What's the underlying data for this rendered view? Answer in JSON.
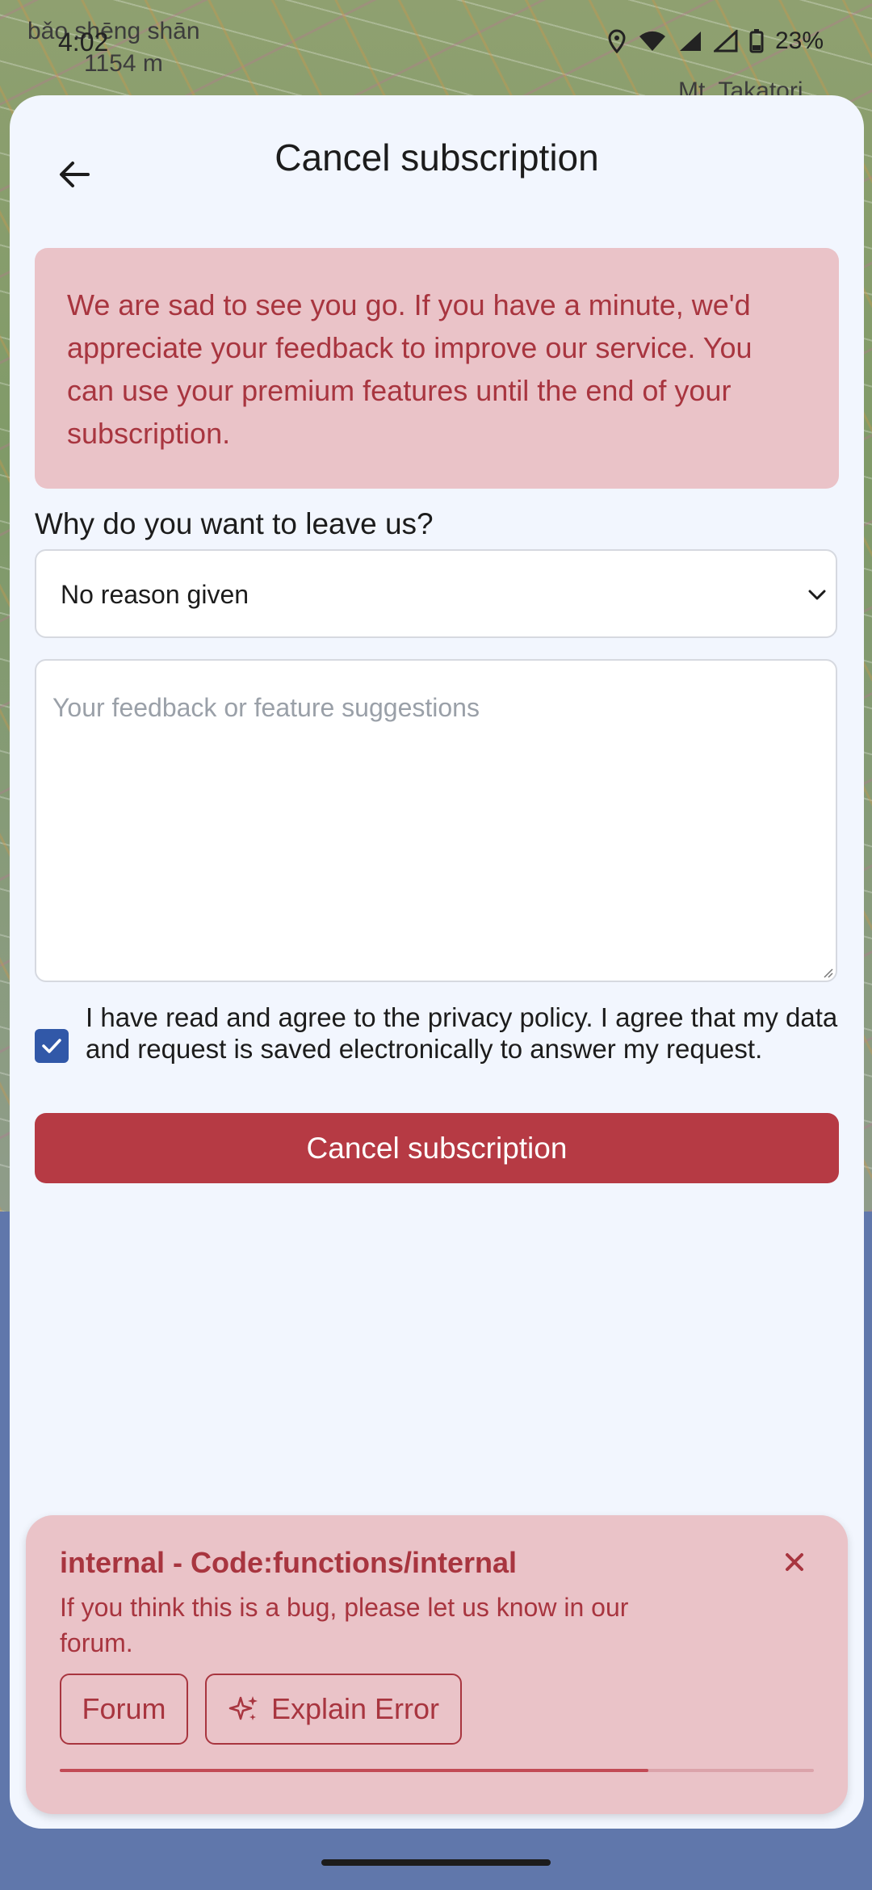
{
  "status_bar": {
    "time": "4:02",
    "battery": "23%",
    "map_labels": [
      "bǎo shēng shān",
      "1154 m",
      "Mt. Takatori"
    ]
  },
  "header": {
    "title": "Cancel subscription",
    "back_icon": "arrow-left-icon"
  },
  "notice": {
    "text": "We are sad to see you go. If you have a minute, we'd appreciate your feedback to improve our service. You can use your premium features until the end of your subscription."
  },
  "form": {
    "question": "Why do you want to leave us?",
    "reason_selected": "No reason given",
    "feedback_placeholder": "Your feedback or feature suggestions",
    "feedback_value": "",
    "consent_checked": true,
    "consent_text": "I have read and agree to the privacy policy. I agree that my data and request is saved electronically to answer my request.",
    "submit_label": "Cancel subscription"
  },
  "error": {
    "title": "internal - Code:functions/internal",
    "message": "If you think this is a bug, please let us know in our forum.",
    "forum_label": "Forum",
    "explain_label": "Explain Error",
    "timeout_progress": 0.78
  },
  "colors": {
    "accent_red": "#b63a44",
    "alert_bg": "#eac3c8",
    "alert_text": "#a8353f",
    "checkbox_blue": "#3158a8",
    "sheet_bg": "#f2f6fe"
  }
}
